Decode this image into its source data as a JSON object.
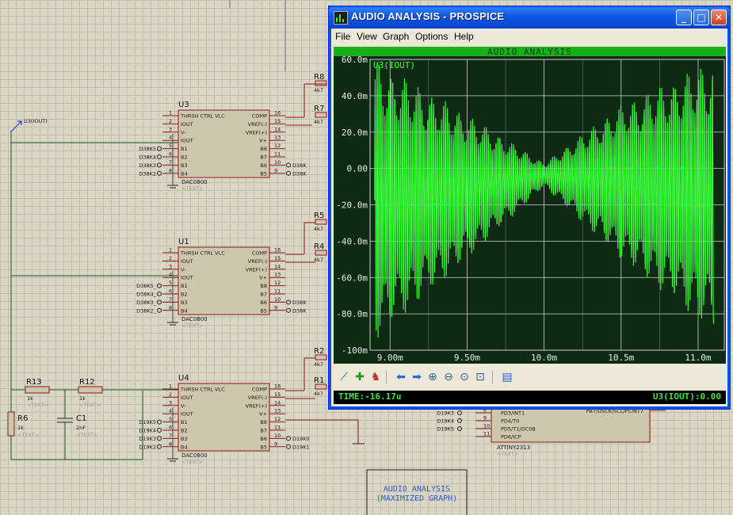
{
  "window": {
    "title": "AUDIO ANALYSIS - PROSPICE",
    "controls": {
      "minimize": "_",
      "maximize": "□",
      "close": "✕"
    },
    "menu": [
      "File",
      "View",
      "Graph",
      "Options",
      "Help"
    ]
  },
  "graph": {
    "title": "AUDIO ANALYSIS",
    "trace_label": "U3(IOUT)",
    "y_ticks": [
      "60.0m",
      "40.0m",
      "20.0m",
      "0.00",
      "-20.0m",
      "-40.0m",
      "-60.0m",
      "-80.0m",
      "-100m"
    ],
    "x_ticks": [
      "9.00m",
      "9.50m",
      "10.0m",
      "10.5m",
      "11.0m"
    ],
    "colors": {
      "background": "#0c2b12",
      "grid": "#cfcfcf",
      "trace": "#3cff3c",
      "title_bar": "#18b018"
    }
  },
  "chart_data": {
    "type": "line",
    "title": "AUDIO ANALYSIS",
    "xlabel": "",
    "ylabel": "",
    "xlim": [
      8.87,
      11.17
    ],
    "ylim": [
      -100,
      60
    ],
    "grid": true,
    "series": [
      {
        "name": "U3(IOUT)",
        "envelope_x": [
          8.9,
          9.5,
          10.0,
          10.5,
          11.1
        ],
        "envelope_max": [
          60,
          30,
          3,
          35,
          60
        ],
        "envelope_min": [
          -95,
          -50,
          -10,
          -50,
          -90
        ]
      }
    ]
  },
  "toolbar": {
    "icons": [
      "graph-edit-icon",
      "add-trace-icon",
      "run-simulation-icon",
      "scroll-left-icon",
      "scroll-right-icon",
      "zoom-in-icon",
      "zoom-out-icon",
      "zoom-all-icon",
      "zoom-area-icon",
      "graph-settings-icon"
    ]
  },
  "status": {
    "time": "TIME:-16.17u",
    "value": "U3(IOUT):0.00"
  },
  "schematic": {
    "chips": [
      {
        "ref": "U3",
        "part": "DAC0800",
        "text": "<TEXT>"
      },
      {
        "ref": "U1",
        "part": "DAC0800",
        "text": "<TEXT>"
      },
      {
        "ref": "U4",
        "part": "DAC0800",
        "text": "<TEXT>"
      }
    ],
    "left_pins": [
      "THRSH",
      "CTRL",
      "VLC",
      "IOUT",
      "V-",
      "IOUT",
      "B1",
      "B2",
      "B3",
      "B4"
    ],
    "right_pins": [
      "COMP",
      "VREF(-)",
      "VREF(+)",
      "V+",
      "B8",
      "B7",
      "B6",
      "B5"
    ],
    "pins_left_num": [
      "1",
      "2",
      "3",
      "4",
      "5",
      "6",
      "7",
      "8"
    ],
    "pins_right_num": [
      "16",
      "15",
      "14",
      "13",
      "12",
      "11",
      "10",
      "9"
    ],
    "nets_u3": [
      "D38K5",
      "D38K4",
      "D38K3",
      "D38K2"
    ],
    "nets_u1": [
      "D38K5_",
      "D38K4_",
      "D38K3_",
      "D38K2_"
    ],
    "nets_u4": [
      "D19K5",
      "D19K4",
      "D19K3",
      "D19K2"
    ],
    "nets_u4_right": [
      "D19K0",
      "D19K1"
    ],
    "resistors": [
      "R8",
      "R7",
      "R5",
      "R4",
      "R2",
      "R1",
      "R13",
      "R12",
      "R6"
    ],
    "res_value_4k7": "4k7",
    "res_value_1k": "1k",
    "cap": {
      "ref": "C1",
      "value": "2nF"
    },
    "probe": "U3(IOUT)",
    "mcu": {
      "part": "ATTINY2313",
      "pins_left": [
        "PD3/INT1",
        "PD4/T0",
        "PD5/T1/OC0B",
        "PD6/ICP"
      ],
      "pins_right": "PB7/USCK/SCL/PCINT7",
      "nets": [
        "D19K3",
        "D19K4",
        "D19K5"
      ],
      "nums": [
        "8",
        "9",
        "10",
        "11",
        "19"
      ]
    },
    "graph_box": {
      "line1": "AUDIO ANALYSIS",
      "line2": "(MAXIMIZED GRAPH)"
    },
    "cut_labels": [
      "D38K",
      "D38K"
    ]
  }
}
